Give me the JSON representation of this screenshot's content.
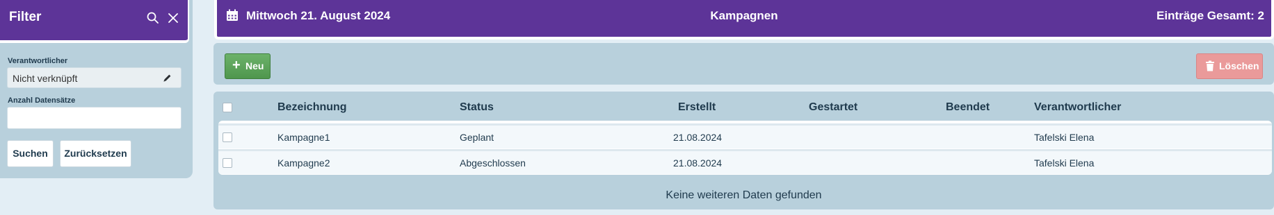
{
  "filter": {
    "title": "Filter",
    "responsible_label": "Verantwortlicher",
    "responsible_value": "Nicht verknüpft",
    "count_label": "Anzahl Datensätze",
    "count_value": "",
    "search_button": "Suchen",
    "reset_button": "Zurücksetzen"
  },
  "topbar": {
    "date": "Mittwoch 21. August 2024",
    "title": "Kampagnen",
    "total": "Einträge Gesamt: 2"
  },
  "toolbar": {
    "new_button": "Neu",
    "delete_button": "Löschen"
  },
  "grid": {
    "columns": [
      "Bezeichnung",
      "Status",
      "Erstellt",
      "Gestartet",
      "Beendet",
      "Verantwortlicher"
    ],
    "rows": [
      {
        "name": "Kampagne1",
        "status": "Geplant",
        "created": "21.08.2024",
        "started": "",
        "ended": "",
        "responsible": "Tafelski Elena"
      },
      {
        "name": "Kampagne2",
        "status": "Abgeschlossen",
        "created": "21.08.2024",
        "started": "",
        "ended": "",
        "responsible": "Tafelski Elena"
      }
    ],
    "footer": "Keine weiteren Daten gefunden"
  },
  "colors": {
    "header_purple": "#5d3498",
    "panel_blue": "#b8d0dc",
    "new_green": "#5aa158",
    "delete_red": "#ea9a9a"
  },
  "icons": [
    "search-icon",
    "close-icon",
    "pencil-icon",
    "calendar-icon",
    "plus-icon",
    "trash-icon",
    "checkbox-icon"
  ]
}
